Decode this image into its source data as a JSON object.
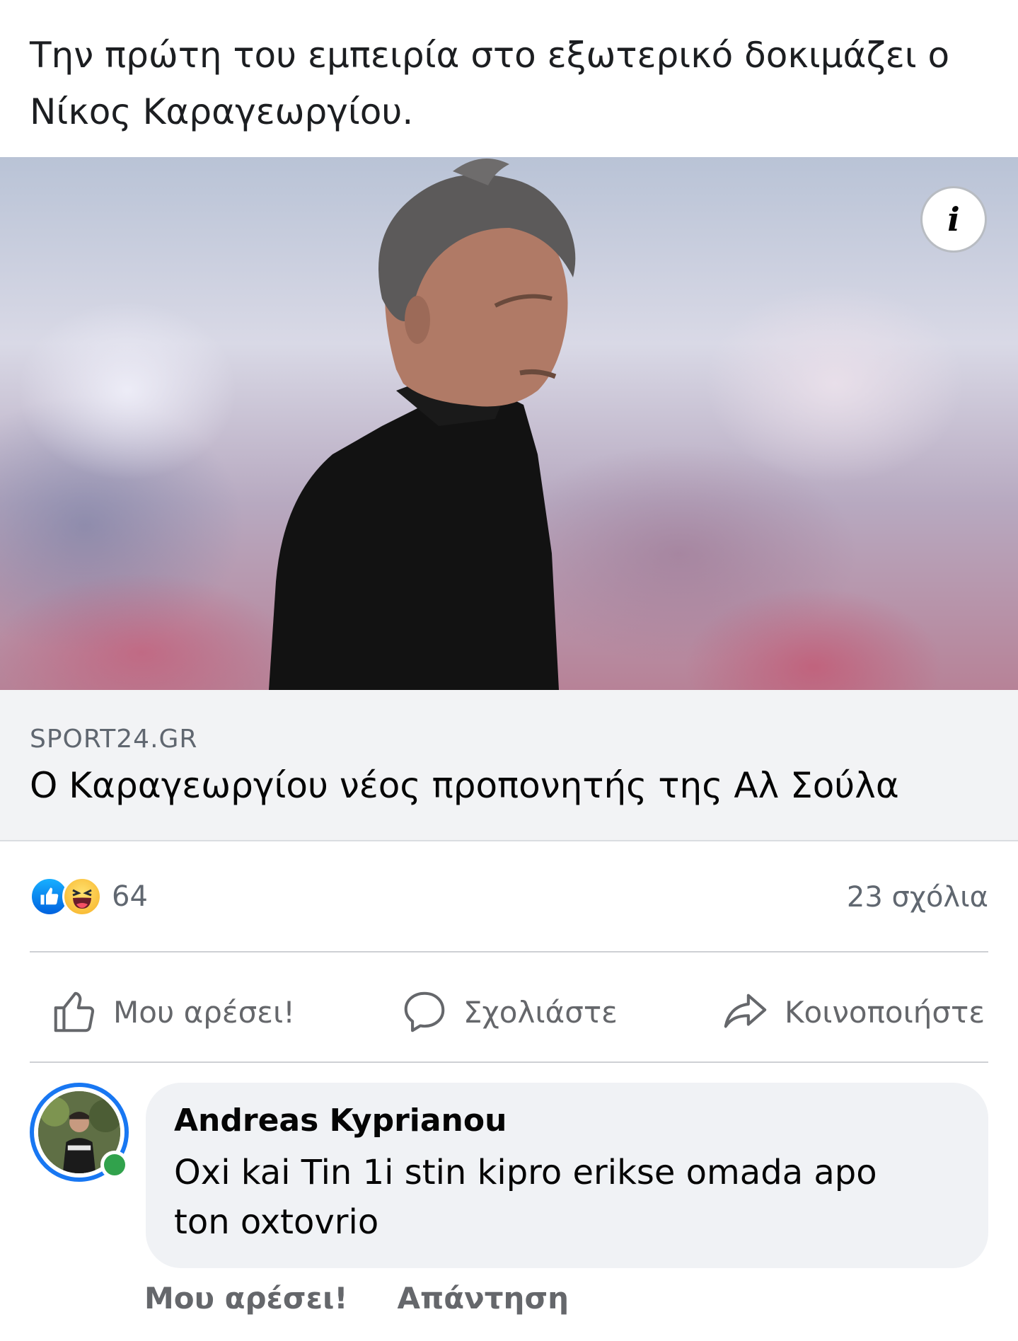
{
  "post": {
    "text": "Την πρώτη του εμπειρία στο εξωτερικό δοκιμάζει ο Νίκος Καραγεωργίου."
  },
  "link_card": {
    "info_icon": "i",
    "domain": "SPORT24.GR",
    "headline": "Ο Καραγεωργίου νέος προπονητής της Αλ Σούλα"
  },
  "stats": {
    "reaction_icons": [
      "like-icon",
      "haha-icon"
    ],
    "reaction_count": "64",
    "comment_count": "23 σχόλια"
  },
  "actions": {
    "like": "Μου αρέσει!",
    "comment": "Σχολιάστε",
    "share": "Κοινοποιήστε"
  },
  "comment": {
    "author": "Andreas Kyprianou",
    "text": "Oxi kai Tin 1i stin kipro erikse omada apo ton oxtovrio",
    "like_label": "Μου αρέσει!",
    "reply_label": "Απάντηση"
  },
  "colors": {
    "accent": "#1877f2",
    "online": "#31a24c",
    "muted_text": "#65676b"
  }
}
